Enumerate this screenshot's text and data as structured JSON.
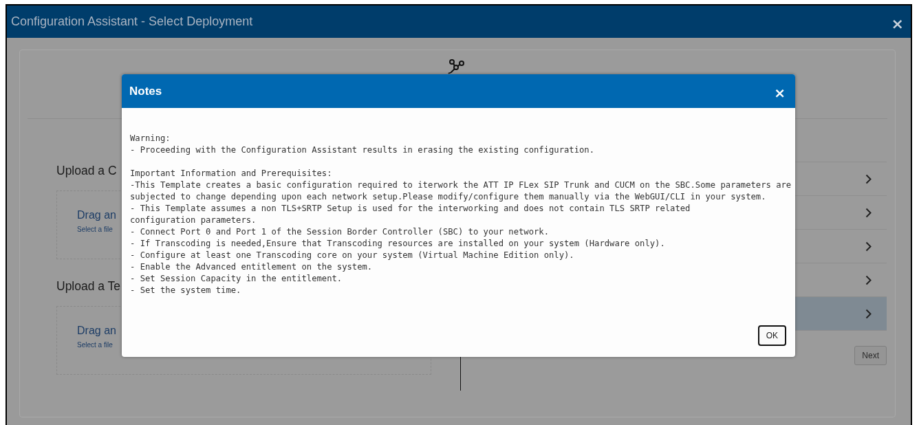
{
  "window": {
    "title": "Configuration Assistant - Select Deployment",
    "close": "×"
  },
  "uploads": [
    {
      "heading": "Upload a C",
      "drop_title": "Drag an",
      "drop_hint": "Select a file"
    },
    {
      "heading": "Upload a Te",
      "drop_title": "Drag an",
      "drop_hint": "Select a file"
    }
  ],
  "options": [
    {
      "selected": false
    },
    {
      "selected": false
    },
    {
      "selected": false
    },
    {
      "selected": false
    },
    {
      "selected": true
    }
  ],
  "next_button": "Next",
  "dialog": {
    "title": "Notes",
    "close": "×",
    "blocks": [
      [
        "Warning:",
        "- Proceeding with the Configuration Assistant results in erasing the existing configuration."
      ],
      [
        "Important Information and Prerequisites:",
        "-This Template creates a basic configuration required to iterwork the ATT IP FLex SIP Trunk and CUCM on the SBC.Some parameters are",
        "subjected to change depending upon each network setup.Please modify/configure them manually via the WebGUI/CLI in your system.",
        "- This Template assumes a non TLS+SRTP Setup is used for the interworking and does not contain TLS SRTP related",
        "configuration parameters.",
        "- Connect Port 0 and Port 1 of the Session Border Controller (SBC) to your network.",
        "- If Transcoding is needed,Ensure that Transcoding resources are installed on your system (Hardware only).",
        "- Configure at least one Transcoding core on your system (Virtual Machine Edition only).",
        "- Enable the Advanced entitlement on the system.",
        "- Set Session Capacity in the entitlement.",
        "- Set the system time."
      ]
    ],
    "ok_button": "OK"
  }
}
